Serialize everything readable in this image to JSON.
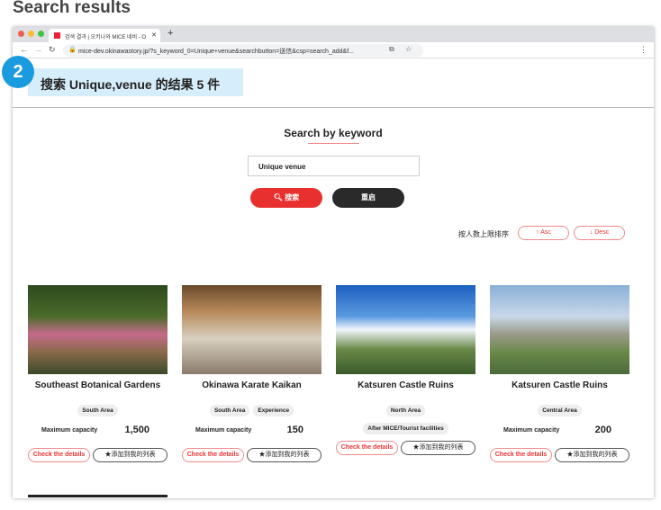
{
  "page_title": "Search results",
  "browser": {
    "tab_title": "검색 결과 | 오키나와 MICE 네비 - O",
    "url": "mice-dev.okinawastory.jp/?s_keyword_0=Unique+venue&searchbutton=送信&csp=search_add&f..."
  },
  "step_badge": "2",
  "result_heading": "搜索 Unique,venue 的结果 5 件",
  "search": {
    "heading": "Search by keyword",
    "value": "Unique venue",
    "search_label": "搜索",
    "reset_label": "重启"
  },
  "sort": {
    "label": "按人数上限排序",
    "asc": "Asc",
    "desc": "Desc"
  },
  "colors": {
    "accent": "#e8312f",
    "badge": "#1a9be0",
    "highlight": "#d6eefb"
  },
  "cards": [
    {
      "name": "Southeast Botanical Gardens",
      "tags": [
        "South Area"
      ],
      "capacity_label": "Maximum capacity",
      "capacity": "1,500",
      "details": "Check the details",
      "add": "★添加到我的列表"
    },
    {
      "name": "Okinawa Karate Kaikan",
      "tags": [
        "South Area",
        "Experience"
      ],
      "capacity_label": "Maximum capacity",
      "capacity": "150",
      "details": "Check the details",
      "add": "★添加到我的列表"
    },
    {
      "name": "Katsuren Castle Ruins",
      "tags": [
        "North Area",
        "After MICE/Tourist facilities"
      ],
      "details": "Check the details",
      "add": "★添加到我的列表"
    },
    {
      "name": "Katsuren Castle Ruins",
      "tags": [
        "Central Area"
      ],
      "capacity_label": "Maximum capacity",
      "capacity": "200",
      "details": "Check the details",
      "add": "★添加到我的列表"
    }
  ]
}
